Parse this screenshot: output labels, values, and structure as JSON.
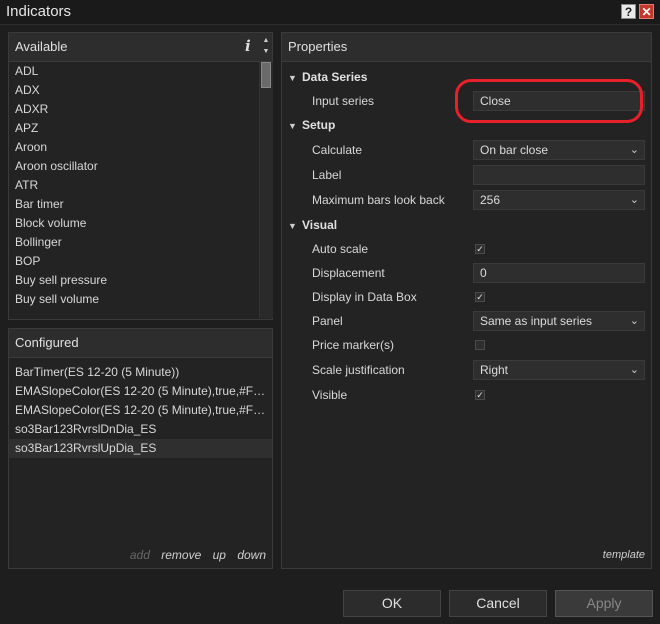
{
  "window": {
    "title": "Indicators",
    "help_glyph": "?",
    "close_glyph": "✕"
  },
  "available": {
    "header": "Available",
    "info_glyph": "i",
    "items": [
      "ADL",
      "ADX",
      "ADXR",
      "APZ",
      "Aroon",
      "Aroon oscillator",
      "ATR",
      "Bar timer",
      "Block volume",
      "Bollinger",
      "BOP",
      "Buy sell pressure",
      "Buy sell volume"
    ]
  },
  "configured": {
    "header": "Configured",
    "items": [
      "BarTimer(ES 12-20 (5 Minute))",
      "EMASlopeColor(ES 12-20 (5 Minute),true,#F…",
      "EMASlopeColor(ES 12-20 (5 Minute),true,#F…",
      "so3Bar123RvrslDnDia_ES",
      "so3Bar123RvrslUpDia_ES"
    ],
    "selected_index": 4,
    "actions": {
      "add": "add",
      "remove": "remove",
      "up": "up",
      "down": "down"
    }
  },
  "properties": {
    "header": "Properties",
    "sections": {
      "data_series": "Data Series",
      "setup": "Setup",
      "visual": "Visual"
    },
    "input_series": {
      "label": "Input series",
      "value": "Close"
    },
    "calculate": {
      "label": "Calculate",
      "value": "On bar close"
    },
    "label": {
      "label": "Label",
      "value": ""
    },
    "max_bars": {
      "label": "Maximum bars look back",
      "value": "256"
    },
    "auto_scale": {
      "label": "Auto scale",
      "checked": true
    },
    "displacement": {
      "label": "Displacement",
      "value": "0"
    },
    "display_in_data_box": {
      "label": "Display in Data Box",
      "checked": true
    },
    "panel": {
      "label": "Panel",
      "value": "Same as input series"
    },
    "price_markers": {
      "label": "Price marker(s)",
      "checked": false
    },
    "scale_justification": {
      "label": "Scale justification",
      "value": "Right"
    },
    "visible": {
      "label": "Visible",
      "checked": true
    },
    "template": "template"
  },
  "buttons": {
    "ok": "OK",
    "cancel": "Cancel",
    "apply": "Apply"
  },
  "colors": {
    "highlight": "#e8202a",
    "background": "#1e1e1e",
    "panel": "#232323"
  }
}
